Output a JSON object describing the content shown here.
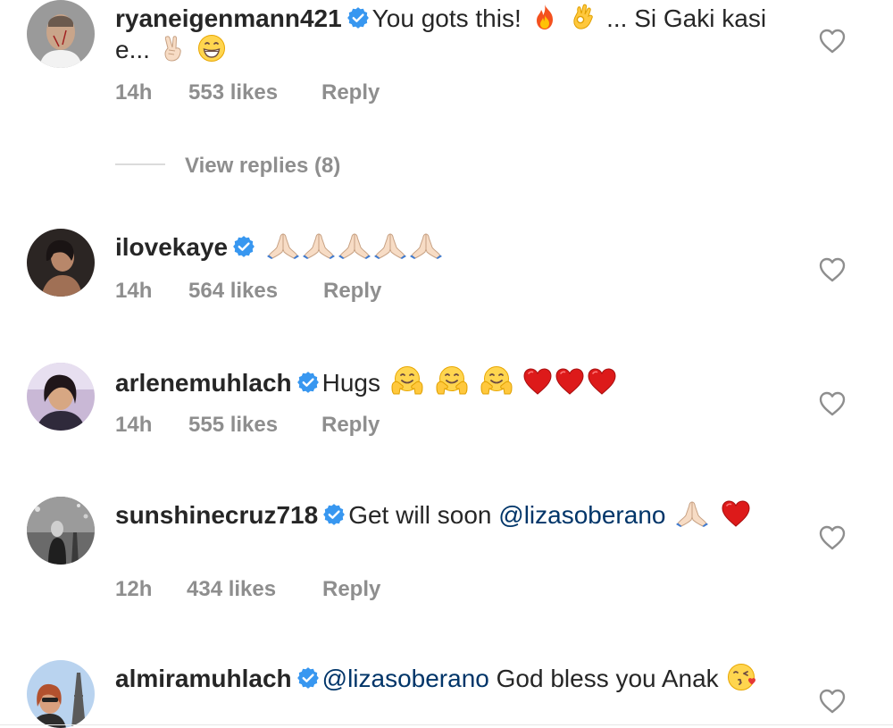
{
  "comments": [
    {
      "username": "ryaneigenmann421",
      "text_before": "You gots this!",
      "text_mid": "... Si Gaki kasi e...",
      "mention": "",
      "text_after": "",
      "time": "14h",
      "likes": "553 likes",
      "reply": "Reply",
      "emojis": [
        "fire-emoji",
        "ok-hand-emoji",
        "victory-hand-emoji",
        "grinning-face-emoji"
      ]
    },
    {
      "username": "ilovekaye",
      "text_before": "",
      "time": "14h",
      "likes": "564 likes",
      "reply": "Reply",
      "emojis": [
        "folded-hands-emoji",
        "folded-hands-emoji",
        "folded-hands-emoji",
        "folded-hands-emoji",
        "folded-hands-emoji"
      ]
    },
    {
      "username": "arlenemuhlach",
      "text_before": "Hugs",
      "time": "14h",
      "likes": "555 likes",
      "reply": "Reply",
      "emojis": [
        "hugging-face-emoji",
        "hugging-face-emoji",
        "hugging-face-emoji",
        "red-heart-emoji",
        "red-heart-emoji",
        "red-heart-emoji"
      ]
    },
    {
      "username": "sunshinecruz718",
      "text_before": "Get will soon",
      "mention": "@lizasoberano",
      "time": "12h",
      "likes": "434 likes",
      "reply": "Reply",
      "emojis": [
        "folded-hands-emoji",
        "red-heart-emoji"
      ]
    },
    {
      "username": "almiramuhlach",
      "mention": "@lizasoberano",
      "text_after": "God bless you Anak",
      "emojis": [
        "face-blowing-kiss-emoji"
      ]
    }
  ],
  "view_replies": "View replies (8)",
  "colors": {
    "username": "#262626",
    "meta": "#8e8e8e",
    "mention": "#003569",
    "verified": "#3897f0",
    "heart_outline": "#8e8e8e"
  }
}
